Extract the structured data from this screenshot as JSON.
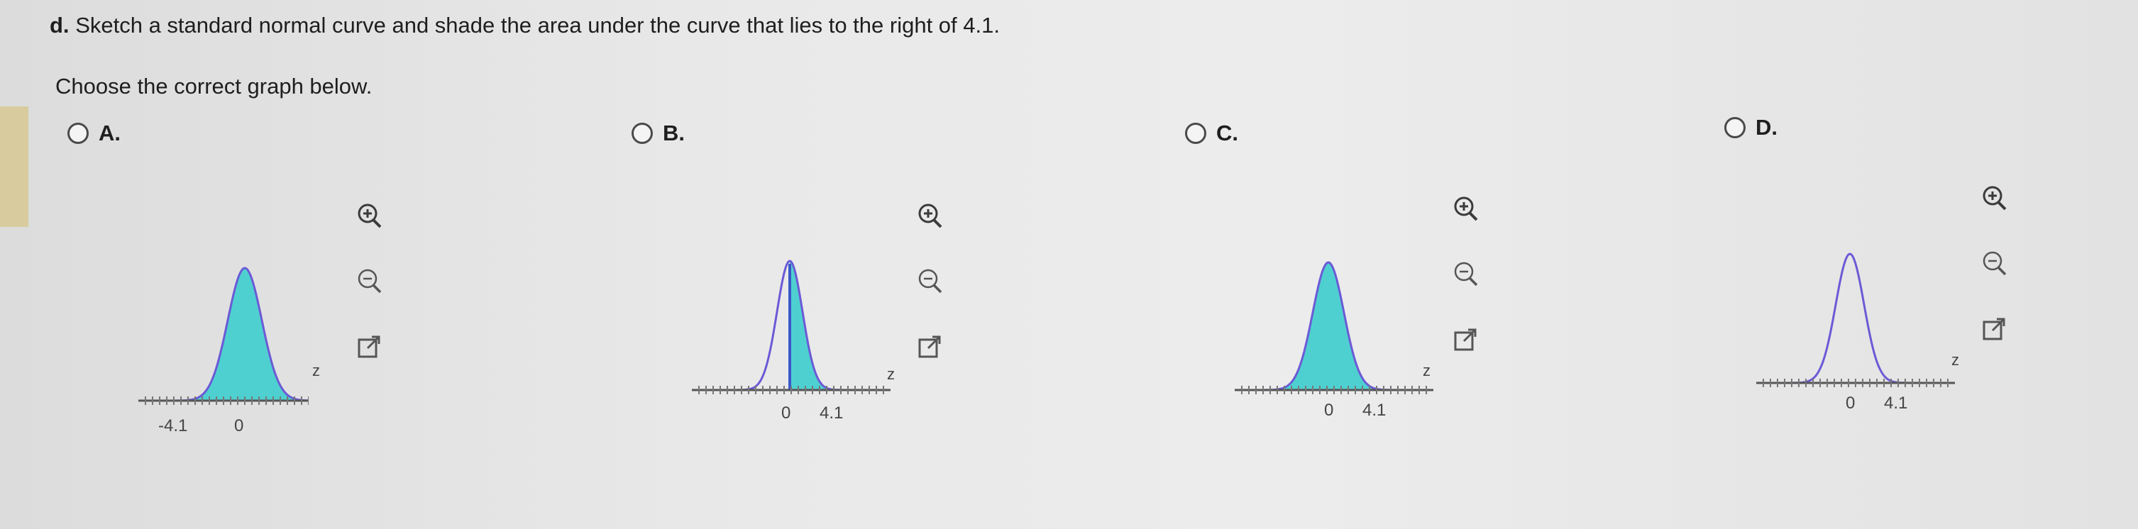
{
  "question": {
    "part": "d.",
    "text": "Sketch a standard normal curve and shade the area under the curve that lies to the right of 4.1."
  },
  "instruction": "Choose the correct graph below.",
  "axis_label": "z",
  "colors": {
    "shade": "#4fd0d0",
    "curve": "#6b5ad6",
    "axis": "#555555"
  },
  "options": [
    {
      "label": "A.",
      "ticks": [
        "-4.1",
        "0"
      ],
      "shading": "left-tail-to-0"
    },
    {
      "label": "B.",
      "ticks": [
        "0",
        "4.1"
      ],
      "shading": "right-half"
    },
    {
      "label": "C.",
      "ticks": [
        "0",
        "4.1"
      ],
      "shading": "full"
    },
    {
      "label": "D.",
      "ticks": [
        "0",
        "4.1"
      ],
      "shading": "none"
    }
  ],
  "tools": [
    "zoom-in-icon",
    "zoom-out-icon",
    "popout-icon"
  ]
}
